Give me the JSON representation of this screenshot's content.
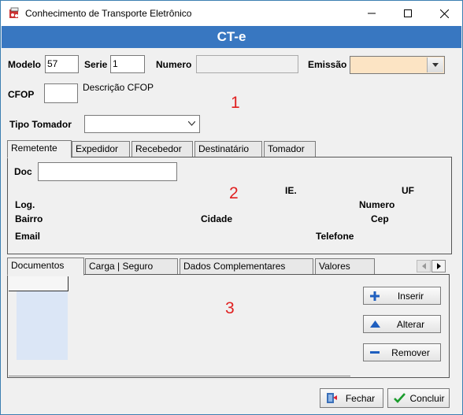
{
  "window": {
    "title": "Conhecimento de Transporte Eletrônico"
  },
  "banner": {
    "title": "CT-e"
  },
  "header": {
    "modelo_label": "Modelo",
    "modelo_value": "57",
    "serie_label": "Serie",
    "serie_value": "1",
    "numero_label": "Numero",
    "numero_value": "",
    "emissao_label": "Emissão",
    "emissao_value": "",
    "cfop_label": "CFOP",
    "cfop_value": "",
    "descricao_cfop_label": "Descrição CFOP",
    "tipo_tomador_label": "Tipo Tomador",
    "tipo_tomador_value": ""
  },
  "annotations": {
    "one": "1",
    "two": "2",
    "three": "3"
  },
  "party_tabs": [
    "Remetente",
    "Expedidor",
    "Recebedor",
    "Destinatário",
    "Tomador"
  ],
  "party": {
    "doc_label": "Doc",
    "doc_value": "",
    "ie_label": "IE.",
    "uf_label": "UF",
    "log_label": "Log.",
    "numero_label": "Numero",
    "bairro_label": "Bairro",
    "cidade_label": "Cidade",
    "cep_label": "Cep",
    "email_label": "Email",
    "telefone_label": "Telefone"
  },
  "detail_tabs": [
    "Documentos",
    "Carga | Seguro",
    "Dados Complementares",
    "Valores"
  ],
  "detail_buttons": {
    "inserir": "Inserir",
    "alterar": "Alterar",
    "remover": "Remover"
  },
  "footer": {
    "fechar": "Fechar",
    "concluir": "Concluir"
  },
  "colors": {
    "banner": "#3877c1",
    "emissao_bg": "#fce4c4",
    "annotation": "#e02020"
  }
}
